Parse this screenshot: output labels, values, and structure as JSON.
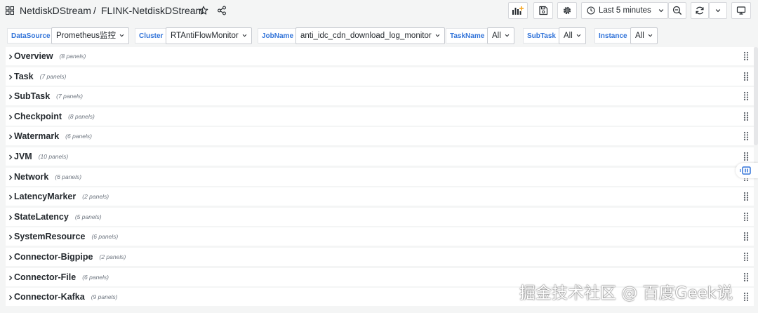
{
  "header": {
    "folder": "NetdiskDStream",
    "separator": "/",
    "dashboard_title": "FLINK-NetdiskDStream",
    "time_range": "Last 5 minutes"
  },
  "variables": [
    {
      "label": "DataSource",
      "value": "Prometheus监控"
    },
    {
      "label": "Cluster",
      "value": "RTAntiFlowMonitor"
    },
    {
      "label": "JobName",
      "value": "anti_idc_cdn_download_log_monitor"
    },
    {
      "label": "TaskName",
      "value": "All"
    },
    {
      "label": "SubTask",
      "value": "All"
    },
    {
      "label": "Instance",
      "value": "All"
    }
  ],
  "rows": [
    {
      "title": "Overview",
      "count": "(8 panels)"
    },
    {
      "title": "Task",
      "count": "(7 panels)"
    },
    {
      "title": "SubTask",
      "count": "(7 panels)"
    },
    {
      "title": "Checkpoint",
      "count": "(8 panels)"
    },
    {
      "title": "Watermark",
      "count": "(6 panels)"
    },
    {
      "title": "JVM",
      "count": "(10 panels)"
    },
    {
      "title": "Network",
      "count": "(6 panels)"
    },
    {
      "title": "LatencyMarker",
      "count": "(2 panels)"
    },
    {
      "title": "StateLatency",
      "count": "(5 panels)"
    },
    {
      "title": "SystemResource",
      "count": "(6 panels)"
    },
    {
      "title": "Connector-Bigpipe",
      "count": "(2 panels)"
    },
    {
      "title": "Connector-File",
      "count": "(6 panels)"
    },
    {
      "title": "Connector-Kafka",
      "count": "(9 panels)"
    }
  ],
  "watermark": "掘金技术社区 @ 百度Geek说",
  "icons": {
    "dashboards": "grid-icon",
    "favorite": "star-icon",
    "share": "share-icon",
    "add_panel": "add-panel-icon",
    "save": "save-icon",
    "settings": "gear-icon",
    "time": "clock-icon",
    "zoom_out": "zoom-out-icon",
    "refresh": "refresh-icon",
    "tv_mode": "monitor-icon"
  },
  "colors": {
    "accent": "#3274d9",
    "panel_add": "#f5a623",
    "background": "#f4f5f5",
    "row_background": "#ffffff"
  }
}
